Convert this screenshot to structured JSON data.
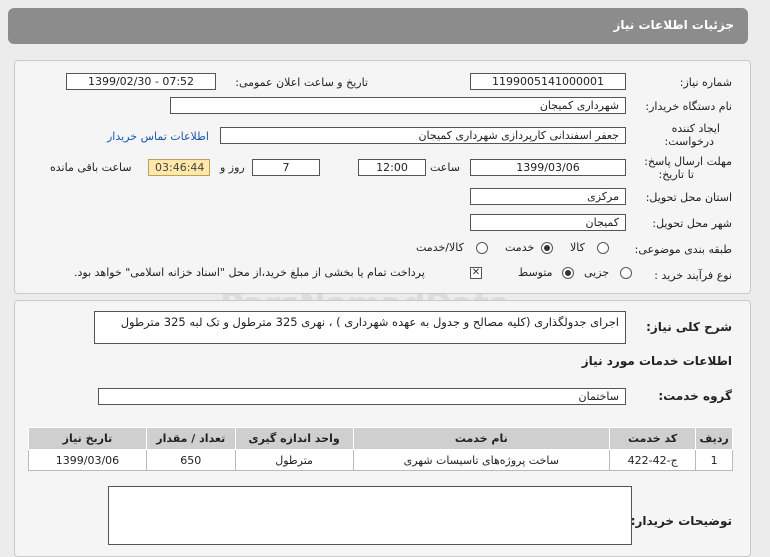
{
  "header": {
    "title": "جزئیات اطلاعات نیاز"
  },
  "fields": {
    "need_number_label": "شماره نیاز:",
    "need_number": "1199005141000001",
    "announce_label": "تاریخ و ساعت اعلان عمومی:",
    "announce_value": "1399/02/30 - 07:52",
    "buyer_org_label": "نام دستگاه خریدار:",
    "buyer_org": "شهرداری کمیجان",
    "requester_label_1": "ایجاد کننده",
    "requester_label_2": "درخواست:",
    "requester": "جعفر  اسفندانی  کارپردازی شهرداری کمیجان",
    "contact_link": "اطلاعات تماس خریدار",
    "deadline_label_1": "مهلت ارسال پاسخ:",
    "deadline_label_2": "تا تاریخ:",
    "deadline_date": "1399/03/06",
    "time_label": "ساعت",
    "deadline_time": "12:00",
    "days_value": "7",
    "days_label": "روز و",
    "remaining_time": "03:46:44",
    "remaining_label": "ساعت باقی مانده",
    "province_label": "استان محل تحویل:",
    "province": "مرکزی",
    "city_label": "شهر محل تحویل:",
    "city": "کمیجان",
    "category_label": "طبقه بندی موضوعی:",
    "category_options": [
      "کالا",
      "خدمت",
      "کالا/خدمت"
    ],
    "category_selected": "خدمت",
    "process_label": "نوع فرآیند خرید :",
    "process_options": [
      "جزیی",
      "متوسط"
    ],
    "process_selected": "متوسط",
    "payment_note": "پرداخت تمام یا بخشی از مبلغ خرید،از محل \"اسناد خزانه اسلامی\" خواهد بود."
  },
  "details": {
    "summary_label": "شرح کلی نیاز:",
    "summary": "اجرای جدولگذاری (کلیه مصالح و جدول به عهده شهرداری ) ، نهری 325 مترطول و تک لبه 325 مترطول",
    "services_title": "اطلاعات خدمات مورد نیاز",
    "service_group_label": "گروه خدمت:",
    "service_group": "ساختمان",
    "buyer_notes_label": "توضیحات خریدار:"
  },
  "table": {
    "headers": [
      "ردیف",
      "کد خدمت",
      "نام خدمت",
      "واحد اندازه گیری",
      "تعداد / مقدار",
      "تاریخ نیاز"
    ],
    "rows": [
      [
        "1",
        "ج-42-422",
        "ساخت پروژه‌های تاسیسات شهری",
        "مترطول",
        "650",
        "1399/03/06"
      ]
    ]
  },
  "watermark": {
    "line1": "ParsNamadData",
    "line2": "مرکز فراوری اطلاعات پارس نماد داده ها",
    "line3": "پایگاه اطلاع رسانی مناقصه ومزایده",
    "line4": "۰۲۱-۸۸۳۴۹۶۷۰-۵"
  },
  "colors": {
    "header_bg": "#8c8c8c",
    "timer_bg": "#ffe8a8",
    "link": "#1a55b0"
  }
}
